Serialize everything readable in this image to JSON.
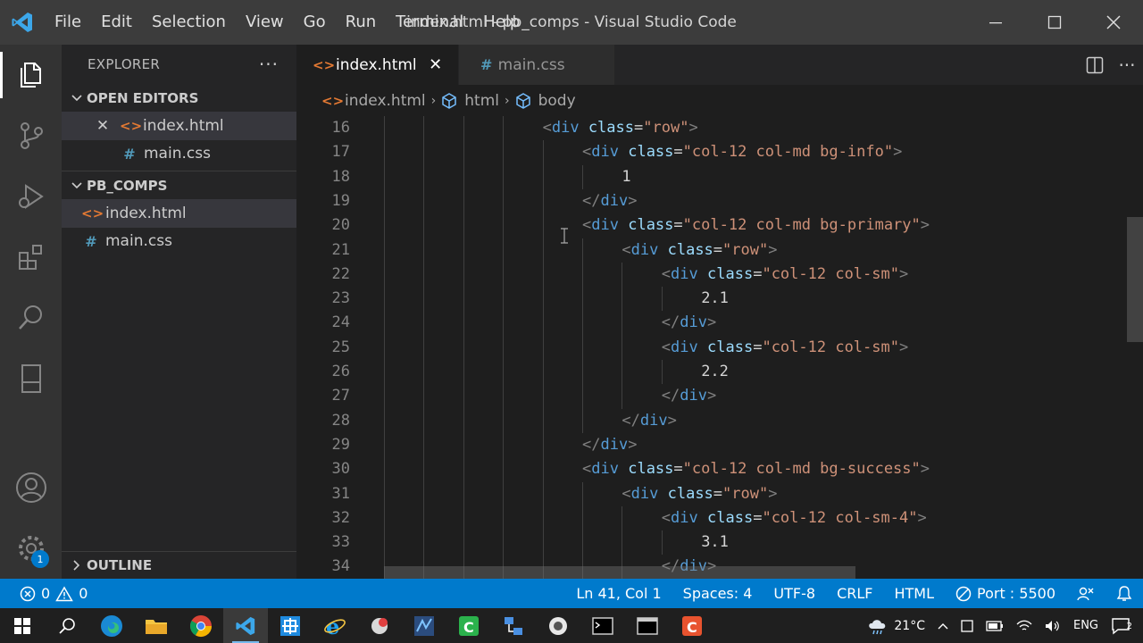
{
  "window": {
    "title": "index.html - pb_comps - Visual Studio Code",
    "menu": [
      "File",
      "Edit",
      "Selection",
      "View",
      "Go",
      "Run",
      "Terminal",
      "Help"
    ]
  },
  "sidebar": {
    "title": "EXPLORER",
    "open_editors": {
      "header": "OPEN EDITORS",
      "items": [
        {
          "name": "index.html",
          "type": "html"
        },
        {
          "name": "main.css",
          "type": "css"
        }
      ]
    },
    "project": {
      "header": "PB_COMPS",
      "items": [
        {
          "name": "index.html",
          "type": "html"
        },
        {
          "name": "main.css",
          "type": "css"
        }
      ]
    },
    "outline": "OUTLINE"
  },
  "activity": {
    "settings_badge": "1"
  },
  "tabs": [
    {
      "label": "index.html",
      "type": "html"
    },
    {
      "label": "main.css",
      "type": "css"
    }
  ],
  "breadcrumb": [
    "index.html",
    "html",
    "body"
  ],
  "code": {
    "lines": [
      {
        "n": "16",
        "indent": 4,
        "tokens": [
          [
            "tg",
            "<"
          ],
          [
            "tn",
            "div"
          ],
          [
            "tx",
            " "
          ],
          [
            "at",
            "class"
          ],
          [
            "tx",
            "="
          ],
          [
            "av",
            "\"row\""
          ],
          [
            "tg",
            ">"
          ]
        ]
      },
      {
        "n": "17",
        "indent": 5,
        "tokens": [
          [
            "tg",
            "<"
          ],
          [
            "tn",
            "div"
          ],
          [
            "tx",
            " "
          ],
          [
            "at",
            "class"
          ],
          [
            "tx",
            "="
          ],
          [
            "av",
            "\"col-12 col-md bg-info\""
          ],
          [
            "tg",
            ">"
          ]
        ]
      },
      {
        "n": "18",
        "indent": 6,
        "tokens": [
          [
            "tx",
            "1"
          ]
        ]
      },
      {
        "n": "19",
        "indent": 5,
        "tokens": [
          [
            "tg",
            "</"
          ],
          [
            "tn",
            "div"
          ],
          [
            "tg",
            ">"
          ]
        ]
      },
      {
        "n": "20",
        "indent": 5,
        "tokens": [
          [
            "tg",
            "<"
          ],
          [
            "tn",
            "div"
          ],
          [
            "tx",
            " "
          ],
          [
            "at",
            "class"
          ],
          [
            "tx",
            "="
          ],
          [
            "av",
            "\"col-12 col-md bg-primary\""
          ],
          [
            "tg",
            ">"
          ]
        ]
      },
      {
        "n": "21",
        "indent": 6,
        "tokens": [
          [
            "tg",
            "<"
          ],
          [
            "tn",
            "div"
          ],
          [
            "tx",
            " "
          ],
          [
            "at",
            "class"
          ],
          [
            "tx",
            "="
          ],
          [
            "av",
            "\"row\""
          ],
          [
            "tg",
            ">"
          ]
        ]
      },
      {
        "n": "22",
        "indent": 7,
        "tokens": [
          [
            "tg",
            "<"
          ],
          [
            "tn",
            "div"
          ],
          [
            "tx",
            " "
          ],
          [
            "at",
            "class"
          ],
          [
            "tx",
            "="
          ],
          [
            "av",
            "\"col-12 col-sm\""
          ],
          [
            "tg",
            ">"
          ]
        ]
      },
      {
        "n": "23",
        "indent": 8,
        "tokens": [
          [
            "tx",
            "2.1"
          ]
        ]
      },
      {
        "n": "24",
        "indent": 7,
        "tokens": [
          [
            "tg",
            "</"
          ],
          [
            "tn",
            "div"
          ],
          [
            "tg",
            ">"
          ]
        ]
      },
      {
        "n": "25",
        "indent": 7,
        "tokens": [
          [
            "tg",
            "<"
          ],
          [
            "tn",
            "div"
          ],
          [
            "tx",
            " "
          ],
          [
            "at",
            "class"
          ],
          [
            "tx",
            "="
          ],
          [
            "av",
            "\"col-12 col-sm\""
          ],
          [
            "tg",
            ">"
          ]
        ]
      },
      {
        "n": "26",
        "indent": 8,
        "tokens": [
          [
            "tx",
            "2.2"
          ]
        ]
      },
      {
        "n": "27",
        "indent": 7,
        "tokens": [
          [
            "tg",
            "</"
          ],
          [
            "tn",
            "div"
          ],
          [
            "tg",
            ">"
          ]
        ]
      },
      {
        "n": "28",
        "indent": 6,
        "tokens": [
          [
            "tg",
            "</"
          ],
          [
            "tn",
            "div"
          ],
          [
            "tg",
            ">"
          ]
        ]
      },
      {
        "n": "29",
        "indent": 5,
        "tokens": [
          [
            "tg",
            "</"
          ],
          [
            "tn",
            "div"
          ],
          [
            "tg",
            ">"
          ]
        ]
      },
      {
        "n": "30",
        "indent": 5,
        "tokens": [
          [
            "tg",
            "<"
          ],
          [
            "tn",
            "div"
          ],
          [
            "tx",
            " "
          ],
          [
            "at",
            "class"
          ],
          [
            "tx",
            "="
          ],
          [
            "av",
            "\"col-12 col-md bg-success\""
          ],
          [
            "tg",
            ">"
          ]
        ]
      },
      {
        "n": "31",
        "indent": 6,
        "tokens": [
          [
            "tg",
            "<"
          ],
          [
            "tn",
            "div"
          ],
          [
            "tx",
            " "
          ],
          [
            "at",
            "class"
          ],
          [
            "tx",
            "="
          ],
          [
            "av",
            "\"row\""
          ],
          [
            "tg",
            ">"
          ]
        ]
      },
      {
        "n": "32",
        "indent": 7,
        "tokens": [
          [
            "tg",
            "<"
          ],
          [
            "tn",
            "div"
          ],
          [
            "tx",
            " "
          ],
          [
            "at",
            "class"
          ],
          [
            "tx",
            "="
          ],
          [
            "av",
            "\"col-12 col-sm-4\""
          ],
          [
            "tg",
            ">"
          ]
        ]
      },
      {
        "n": "33",
        "indent": 8,
        "tokens": [
          [
            "tx",
            "3.1"
          ]
        ]
      },
      {
        "n": "34",
        "indent": 7,
        "tokens": [
          [
            "tg",
            "</"
          ],
          [
            "tn",
            "div"
          ],
          [
            "tg",
            ">"
          ]
        ]
      }
    ]
  },
  "statusbar": {
    "errors": "0",
    "warnings": "0",
    "position": "Ln 41, Col 1",
    "spaces": "Spaces: 4",
    "encoding": "UTF-8",
    "eol": "CRLF",
    "language": "HTML",
    "port": "Port : 5500"
  },
  "taskbar": {
    "apps": [
      "windows-start-icon",
      "search-icon",
      "edge-icon",
      "file-explorer-icon",
      "chrome-icon",
      "vscode-icon",
      "snip-icon",
      "ie-icon",
      "app-icon",
      "app2-icon",
      "camtasia-icon",
      "network-icon",
      "app3-icon",
      "terminal-icon",
      "terminal2-icon",
      "recorder-icon"
    ],
    "weather": "21°C",
    "language": "ENG",
    "notification_count": "2"
  },
  "colors": {
    "accent": "#007acc",
    "html_icon": "#e37933",
    "css_icon": "#519aba"
  }
}
